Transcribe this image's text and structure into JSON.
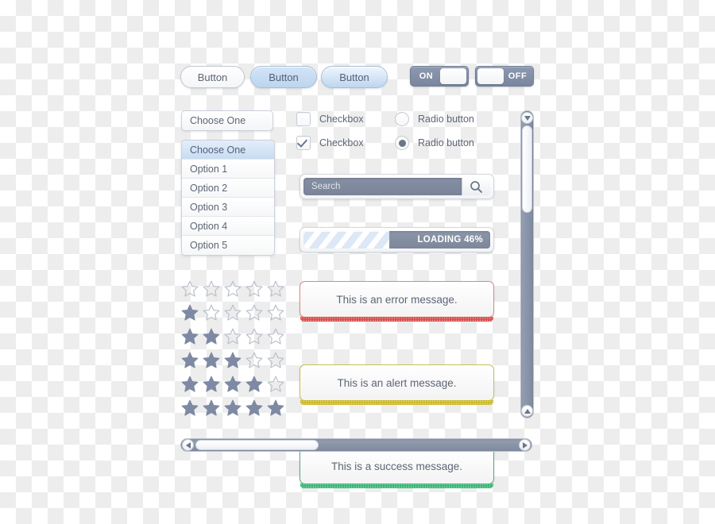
{
  "theme": {
    "accent_slate": "#8d99ae",
    "text_slate": "#5d6675",
    "highlight_blue": "#c8dcf1",
    "error_color": "#d9534f",
    "alert_color": "#ccbb33",
    "success_color": "#3fb878",
    "canvas_checker_light": "#ffffff",
    "canvas_checker_dark": "#ededed"
  },
  "buttons": [
    {
      "label": "Button",
      "state": "default"
    },
    {
      "label": "Button",
      "state": "hover"
    },
    {
      "label": "Button",
      "state": "active"
    }
  ],
  "toggles": [
    {
      "label": "ON",
      "state": "on",
      "knob_side": "right"
    },
    {
      "label": "OFF",
      "state": "off",
      "knob_side": "left"
    }
  ],
  "select": {
    "closed_value": "Choose One",
    "options": [
      {
        "label": "Choose One",
        "selected": true
      },
      {
        "label": "Option 1",
        "selected": false
      },
      {
        "label": "Option 2",
        "selected": false
      },
      {
        "label": "Option 3",
        "selected": false
      },
      {
        "label": "Option 4",
        "selected": false
      },
      {
        "label": "Option 5",
        "selected": false
      }
    ]
  },
  "checkboxes": [
    {
      "label": "Checkbox",
      "checked": false
    },
    {
      "label": "Checkbox",
      "checked": true
    }
  ],
  "radios": [
    {
      "label": "Radio button",
      "checked": false
    },
    {
      "label": "Radio button",
      "checked": true
    }
  ],
  "search": {
    "placeholder": "Search",
    "value": "",
    "icon": "search-icon"
  },
  "progress": {
    "label": "LOADING 46%",
    "percent": 46
  },
  "messages": [
    {
      "text": "This is an error message.",
      "type": "error"
    },
    {
      "text": "This is an alert message.",
      "type": "alert"
    },
    {
      "text": "This is a success message.",
      "type": "success"
    }
  ],
  "ratings": [
    {
      "filled": 0,
      "total": 5
    },
    {
      "filled": 1,
      "total": 5
    },
    {
      "filled": 2,
      "total": 5
    },
    {
      "filled": 3,
      "total": 5
    },
    {
      "filled": 4,
      "total": 5
    },
    {
      "filled": 5,
      "total": 5
    }
  ],
  "scrollbars": {
    "vertical": {
      "top_arrow": "chevron-down-icon",
      "bottom_arrow": "chevron-up-icon",
      "thumb_percent": 30,
      "thumb_offset_percent": 0
    },
    "horizontal": {
      "left_arrow": "chevron-left-icon",
      "right_arrow": "chevron-right-icon",
      "thumb_percent": 36,
      "thumb_offset_percent": 0
    }
  }
}
